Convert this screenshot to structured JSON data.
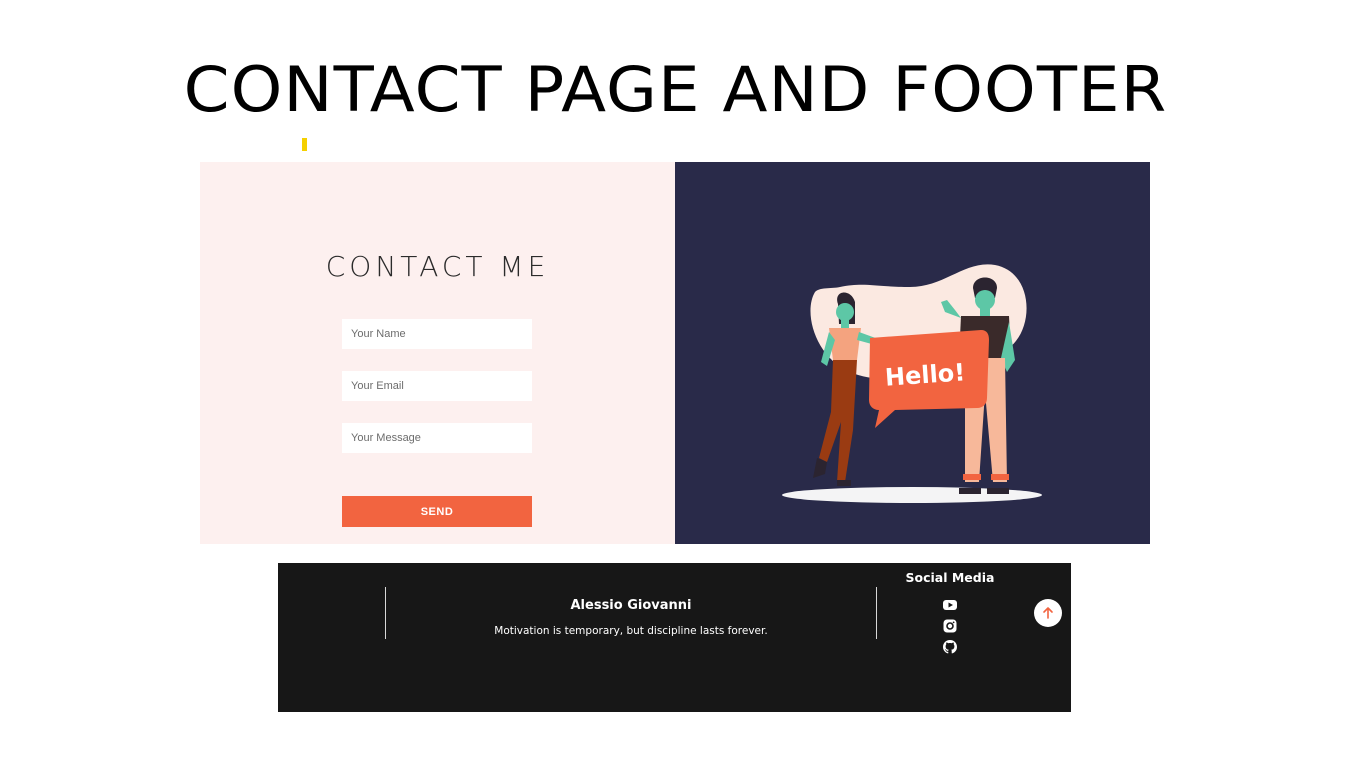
{
  "slide": {
    "title": "CONTACT PAGE AND FOOTER",
    "accent_color": "#f5d000"
  },
  "contact": {
    "heading": "CONTACT ME",
    "name_placeholder": "Your Name",
    "email_placeholder": "Your Email",
    "message_placeholder": "Your Message",
    "send_label": "SEND",
    "left_bg": "#fdf0ef",
    "right_bg": "#292a49",
    "accent": "#f26440",
    "illustration_text": "Hello!"
  },
  "footer": {
    "bg": "#171717",
    "name": "Alessio Giovanni",
    "motto": "Motivation is temporary, but discipline lasts forever.",
    "social_heading": "Social Media",
    "social_icons": [
      "youtube-icon",
      "instagram-icon",
      "github-icon"
    ],
    "top_button_icon": "arrow-up-icon",
    "top_button_color": "#f26440"
  }
}
